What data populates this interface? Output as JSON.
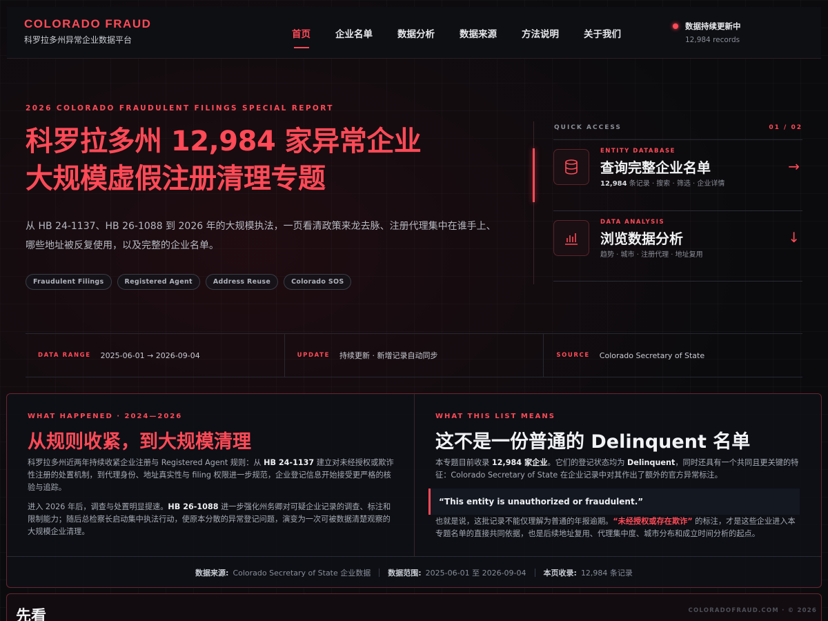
{
  "brand": {
    "title": "COLORADO FRAUD",
    "subtitle": "科罗拉多州异常企业数据平台"
  },
  "nav": {
    "items": [
      "首页",
      "企业名单",
      "数据分析",
      "数据来源",
      "方法说明",
      "关于我们"
    ],
    "active": "首页"
  },
  "status": {
    "label": "数据持续更新中",
    "count": "12,984  records"
  },
  "hero": {
    "kicker": "2026 COLORADO FRAUDULENT FILINGS SPECIAL REPORT",
    "title_line1": "科罗拉多州 12,984 家异常企业",
    "title_line2": "大规模虚假注册清理专题",
    "description": "从 HB 24-1137、HB 26-1088 到 2026 年的大规模执法，一页看清政策来龙去脉、注册代理集中在谁手上、哪些地址被反复使用，以及完整的企业名单。",
    "tags": [
      "Fraudulent Filings",
      "Registered Agent",
      "Address Reuse",
      "Colorado SOS"
    ]
  },
  "quick_access": {
    "label": "QUICK ACCESS",
    "page": "01 / 02",
    "cards": [
      {
        "kicker": "ENTITY DATABASE",
        "title": "查询完整企业名单",
        "meta_bold": "12,984",
        "meta": " 条记录 · 搜索 · 筛选 · 企业详情",
        "arrow": "→",
        "icon": "database-icon"
      },
      {
        "kicker": "DATA ANALYSIS",
        "title": "浏览数据分析",
        "meta_bold": "",
        "meta": "趋势 · 城市 · 注册代理 · 地址复用",
        "arrow": "↓",
        "icon": "bar-chart-icon"
      }
    ]
  },
  "infobar": [
    {
      "key": "DATA RANGE",
      "value": "2025-06-01 → 2026-09-04"
    },
    {
      "key": "UPDATE",
      "value": "持续更新 · 新增记录自动同步"
    },
    {
      "key": "SOURCE",
      "value": "Colorado Secretary of State"
    }
  ],
  "left_panel": {
    "kicker": "WHAT HAPPENED · 2024—2026",
    "title": "从规则收紧，到大规模清理",
    "p1_a": "科罗拉多州近两年持续收紧企业注册与 Registered Agent 规则：从 ",
    "p1_b": "HB 24-1137",
    "p1_c": " 建立对未经授权或欺诈性注册的处置机制，到代理身份、地址真实性与 filing 权限进一步规范，企业登记信息开始接受更严格的核验与追踪。",
    "p2_a": "进入 2026 年后，调查与处置明显提速。",
    "p2_b": "HB 26-1088",
    "p2_c": " 进一步强化州务卿对可疑企业记录的调查、标注和限制能力；随后总检察长启动集中执法行动，使原本分散的异常登记问题，演变为一次可被数据清楚观察的大规模企业清理。"
  },
  "right_panel": {
    "kicker": "WHAT THIS LIST MEANS",
    "title": "这不是一份普通的 Delinquent 名单",
    "p1_a": "本专题目前收录 ",
    "p1_b": "12,984 家企业",
    "p1_c": "。它们的登记状态均为 ",
    "p1_d": "Delinquent",
    "p1_e": "，同时还具有一个共同且更关键的特征：Colorado Secretary of State 在企业记录中对其作出了额外的官方异常标注。",
    "quote": "“This entity is unauthorized or fraudulent.”",
    "p2_a": "也就是说，这批记录不能仅理解为普通的年报逾期。",
    "p2_b": "“未经授权或存在欺诈”",
    "p2_c": " 的标注，才是这些企业进入本专题名单的直接共同依据，也是后续地址复用、代理集中度、城市分布和成立时间分析的起点。"
  },
  "panel_footer": [
    {
      "key": "数据来源:",
      "value": "Colorado Secretary of State 企业数据"
    },
    {
      "key": "数据范围:",
      "value": "2025-06-01 至 2026-09-04"
    },
    {
      "key": "本页收录:",
      "value": "12,984 条记录"
    }
  ],
  "next_section": {
    "title": "先看"
  },
  "copyright": "COLORADOFRAUD.COM · © 2026",
  "colors": {
    "accent": "#ff4a57",
    "background": "#0b0b0e"
  }
}
